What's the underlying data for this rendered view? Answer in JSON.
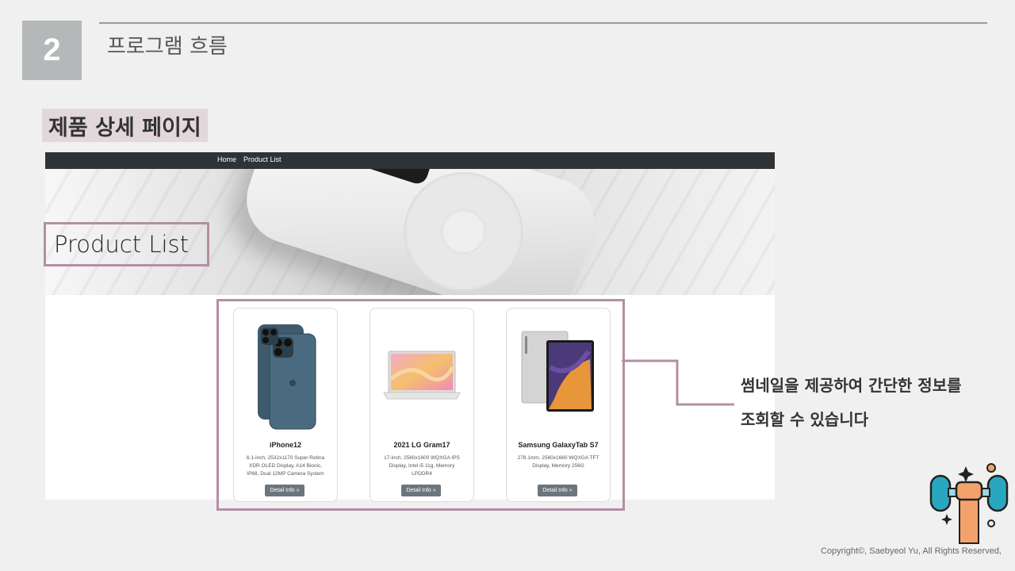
{
  "slide": {
    "number": "2",
    "title": "프로그램 흐름",
    "section_label": "제품 상세 페이지",
    "annotation_line1": "썸네일을 제공하여 간단한 정보를",
    "annotation_line2": "조회할 수 있습니다",
    "copyright": "Copyright©, Saebyeol Yu, All Rights Reserved,"
  },
  "navbar": {
    "home": "Home",
    "product_list": "Product List"
  },
  "hero": {
    "title": "Product List"
  },
  "products": [
    {
      "name": "iPhone12",
      "desc1": "6.1-inch, 2532x1170 Super Retina",
      "desc2": "XDR OLED Display, A14 Bionic,",
      "desc3": "IP68, Dual 12MP Camera System",
      "button": "Detail Info »"
    },
    {
      "name": "2021 LG Gram17",
      "desc1": "17-inch, 2560x1600 WQXGA IPS",
      "desc2": "Display, Intel i5 11g, Memory",
      "desc3": "LPDDR4",
      "button": "Detail Info »"
    },
    {
      "name": "Samsung GalaxyTab S7",
      "desc1": "278.1mm, 2560x1660 WQXGA TFT",
      "desc2": "Display, Memory 256G",
      "desc3": "",
      "button": "Detail Info »"
    }
  ],
  "colors": {
    "accent_border": "#b48ea5",
    "label_bg": "#e2d7dd",
    "navbar_bg": "#2e3338",
    "button_bg": "#6c757d",
    "number_box_bg": "#b5b8b8"
  },
  "icons": {
    "decoration": "dumbbell-lift-icon"
  }
}
